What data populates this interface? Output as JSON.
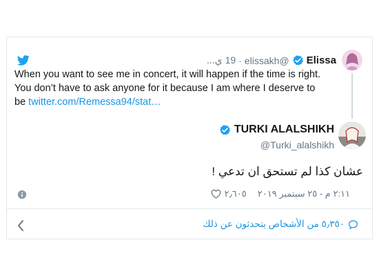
{
  "quoted_tweet": {
    "name": "Elissa",
    "handle": "@elissakh",
    "separator": "·",
    "time": "19 ي...",
    "text": "When you want to see me in concert, it will happen if the time is right. You don’t have to ask anyone for it because I am where I deserve to be ",
    "link": "twitter.com/Remessa94/stat…"
  },
  "tweet": {
    "name": "TURKI ALALSHIKH",
    "handle": "@Turki_alalshikh",
    "text": "عشان كذا لم تستحق ان تدعي !",
    "likes": "٢٫٦٠٥",
    "timestamp": "٢:١١ م - ٢٥ سبتمبر ٢٠١٩"
  },
  "footer": {
    "talking_text": "٥٫٣٥٠ من الأشخاص يتحدثون عن ذلك"
  },
  "colors": {
    "accent": "#1da1f2",
    "link": "#1b95e0",
    "muted": "#657786",
    "border": "#e1e8ed"
  },
  "icons": [
    "twitter-bird-icon",
    "verified-badge-icon",
    "info-icon",
    "heart-icon",
    "speech-bubble-icon",
    "chevron-left-icon"
  ]
}
